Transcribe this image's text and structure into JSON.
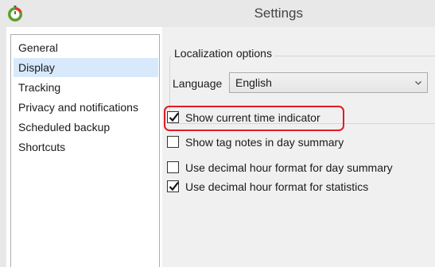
{
  "window": {
    "title": "Settings",
    "app_icon": "stopwatch-icon"
  },
  "sidebar": {
    "items": [
      {
        "label": "General",
        "selected": false
      },
      {
        "label": "Display",
        "selected": true
      },
      {
        "label": "Tracking",
        "selected": false
      },
      {
        "label": "Privacy and notifications",
        "selected": false
      },
      {
        "label": "Scheduled backup",
        "selected": false
      },
      {
        "label": "Shortcuts",
        "selected": false
      }
    ]
  },
  "localization": {
    "group_title": "Localization options",
    "language_label": "Language",
    "language_value": "English",
    "dropdown_icon": "chevron-down-icon"
  },
  "options": [
    {
      "label": "Show current time indicator",
      "checked": true,
      "highlighted": true
    },
    {
      "label": "Show tag notes in day summary",
      "checked": false,
      "highlighted": false
    },
    {
      "label": "Use decimal hour format for day summary",
      "checked": false,
      "highlighted": false
    },
    {
      "label": "Use decimal hour format for statistics",
      "checked": true,
      "highlighted": false
    }
  ],
  "colors": {
    "selection": "#d7e9fb",
    "highlight": "#e31b23",
    "content_bg": "#f0f0f0",
    "titlebar_bg": "#e8e8e8"
  }
}
